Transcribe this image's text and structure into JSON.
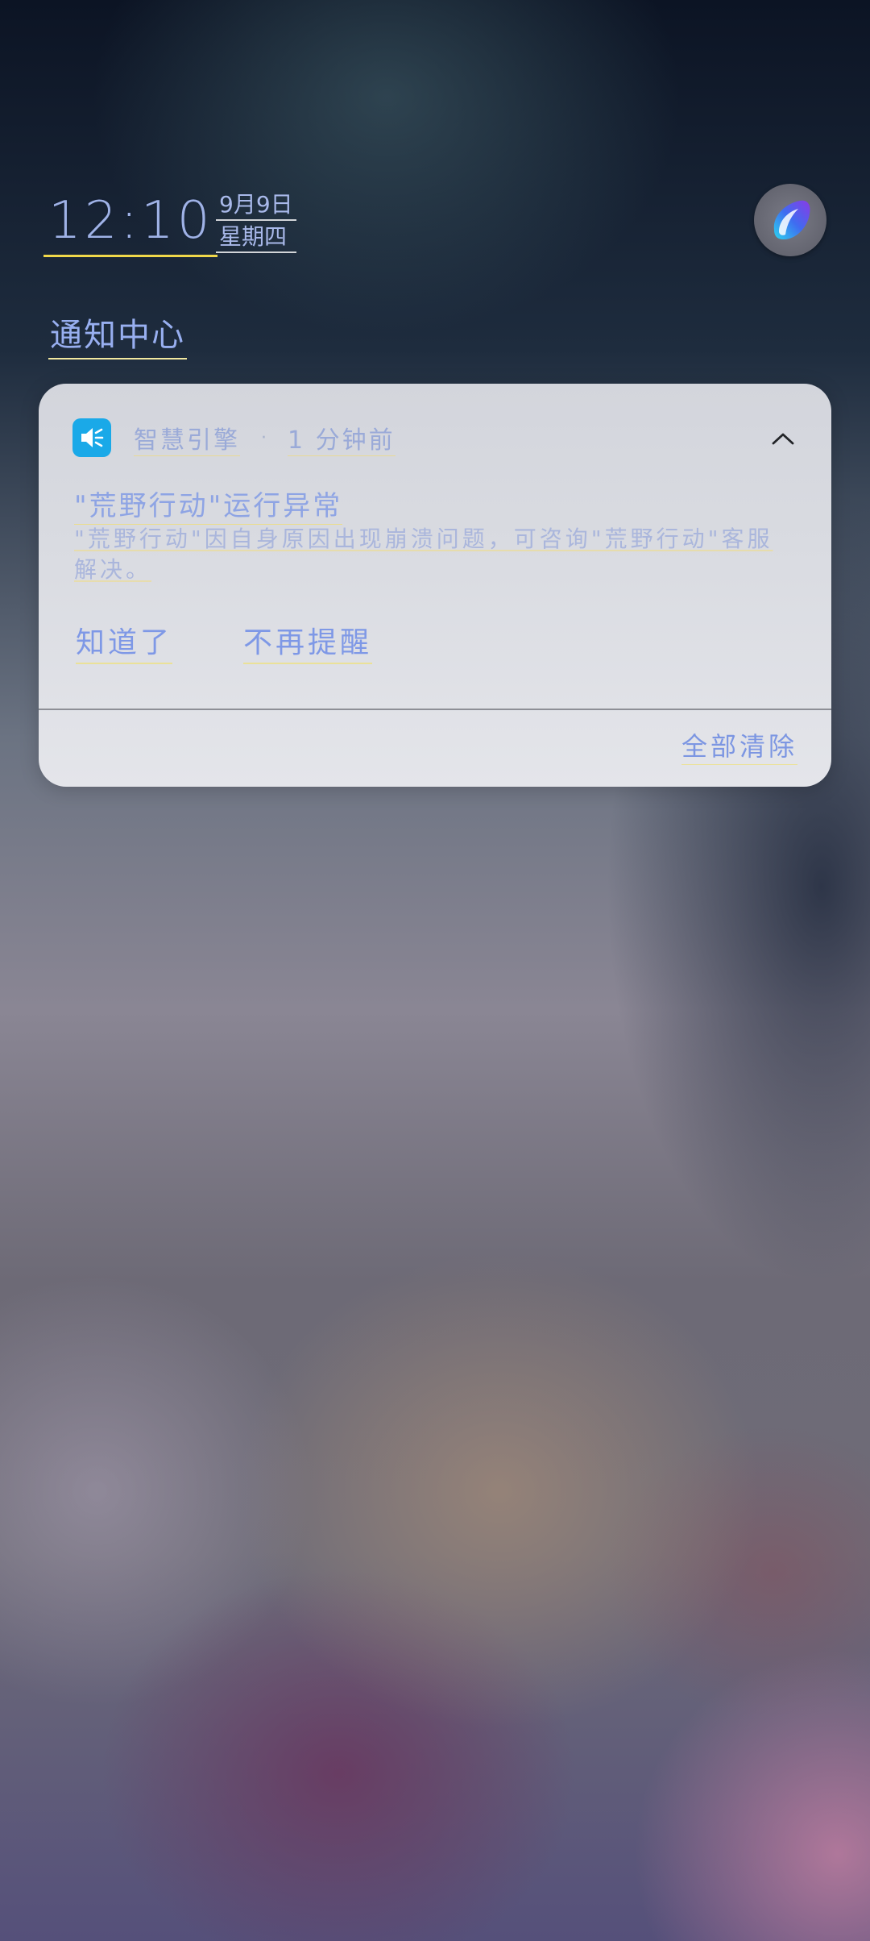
{
  "header": {
    "clock": "12:10",
    "date": "9月9日",
    "weekday": "星期四"
  },
  "notification_center": {
    "title": "通知中心"
  },
  "notification": {
    "app_name": "智慧引擎",
    "separator": "·",
    "time_ago": "1 分钟前",
    "title": "\"荒野行动\"运行异常",
    "body": "\"荒野行动\"因自身原因出现崩溃问题，可咨询\"荒野行动\"客服解决。",
    "actions": {
      "acknowledge": "知道了",
      "no_reminder": "不再提醒"
    },
    "app_icon": "speaker-icon",
    "collapse_icon": "chevron-up-icon"
  },
  "footer": {
    "clear_all": "全部清除"
  },
  "assistant": {
    "icon": "assistant-orb-icon"
  },
  "colors": {
    "app_icon_bg": "#1aa9e8",
    "link_text": "#7e98e6",
    "card_bg": "#d9dbe1"
  }
}
